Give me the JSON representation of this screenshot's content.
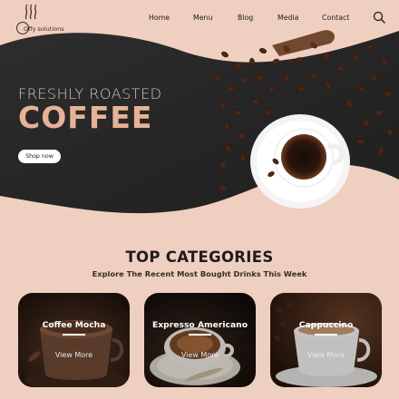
{
  "brand": {
    "name": "Offy solutions",
    "logo_icon": "coffee-steam-icon"
  },
  "nav": {
    "items": [
      {
        "label": "Home"
      },
      {
        "label": "Menu"
      },
      {
        "label": "Blog"
      },
      {
        "label": "Media"
      },
      {
        "label": "Contact"
      }
    ],
    "search_icon": "search-icon"
  },
  "hero": {
    "eyebrow": "FRESHLY ROASTED",
    "title": "COFFEE",
    "cta_label": "Shop now"
  },
  "categories": {
    "title": "TOP CATEGORIES",
    "subtitle": "Explore The Recent Most Bought Drinks This Week",
    "cards": [
      {
        "title": "Coffee Mocha",
        "link": "View More"
      },
      {
        "title": "Expresso Americano",
        "link": "View More"
      },
      {
        "title": "Cappuccino",
        "link": "View More"
      }
    ]
  },
  "colors": {
    "background": "#efcfbf",
    "hero_dark": "#262626",
    "accent": "#e7b295",
    "text": "#1d1d1d"
  }
}
